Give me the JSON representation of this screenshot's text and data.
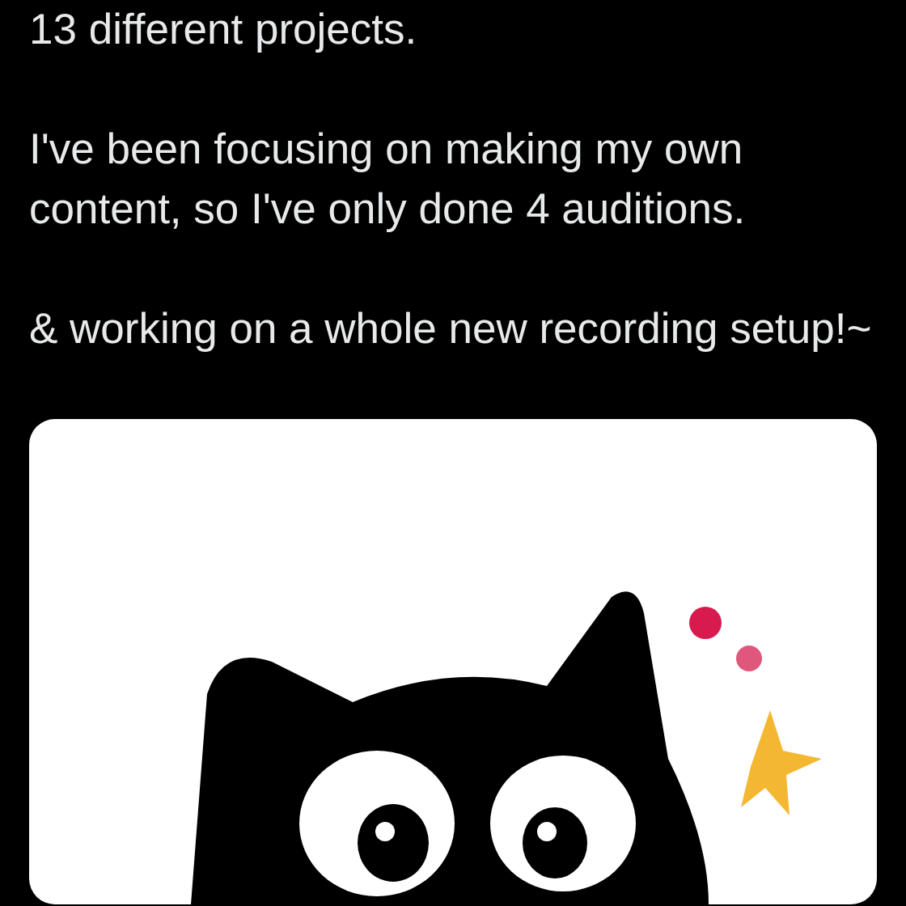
{
  "post": {
    "paragraphs": [
      "13 different projects.",
      "I've been focusing on making my own content, so I've only done 4 auditions.",
      "& working on a whole new recording setup!~"
    ]
  }
}
